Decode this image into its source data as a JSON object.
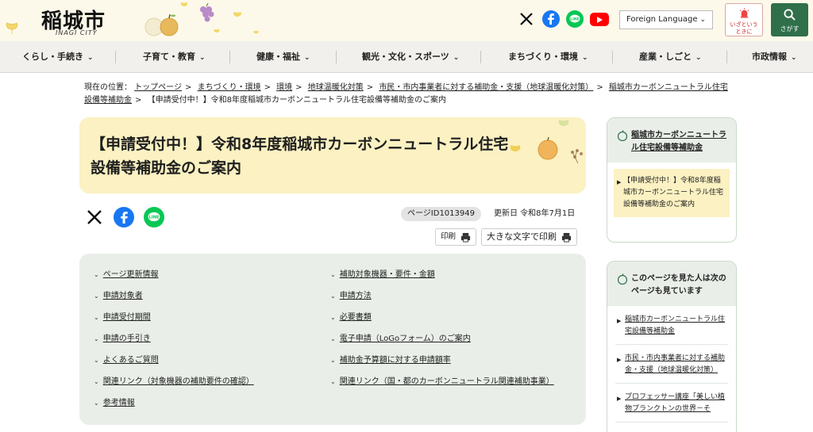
{
  "header": {
    "logo": "稲城市",
    "logo_sub": "INAGI CITY",
    "foreign_language": "Foreign Language",
    "emergency_label_1": "いざという",
    "emergency_label_2": "ときに",
    "search_label": "さがす"
  },
  "nav": {
    "items": [
      "くらし・手続き",
      "子育て・教育",
      "健康・福祉",
      "観光・文化・スポーツ",
      "まちづくり・環境",
      "産業・しごと",
      "市政情報"
    ]
  },
  "breadcrumb": {
    "prefix": "現在の位置：",
    "items": [
      "トップページ",
      "まちづくり・環境",
      "環境",
      "地球温暖化対策",
      "市民・市内事業者に対する補助金・支援（地球温暖化対策）",
      "稲城市カーボンニュートラル住宅設備等補助金"
    ],
    "current": "【申請受付中！】令和8年度稲城市カーボンニュートラル住宅設備等補助金のご案内"
  },
  "page": {
    "title": "【申請受付中！】令和8年度稲城市カーボンニュートラル住宅設備等補助金のご案内",
    "page_id": "ページID1013949",
    "updated": "更新日 令和8年7月1日",
    "print": "印刷",
    "print_large": "大きな文字で印刷"
  },
  "toc": {
    "left": [
      "ページ更新情報",
      "申請対象者",
      "申請受付期間",
      "申請の手引き",
      "よくあるご質問",
      "関連リンク（対象機器の補助要件の確認）",
      "参考情報"
    ],
    "right": [
      "補助対象機器・要件・金額",
      "申請方法",
      "必要書類",
      "電子申請（LoGoフォーム）のご案内",
      "補助金予算額に対する申請額率",
      "関連リンク（国・都のカーボンニュートラル関連補助事業）"
    ]
  },
  "side": {
    "category": "稲城市カーボンニュートラル住宅設備等補助金",
    "current": "【申請受付中！】令和8年度稲城市カーボンニュートラル住宅設備等補助金のご案内",
    "also_viewed": "このページを見た人は次のページも見ています",
    "links": [
      "稲城市カーボンニュートラル住宅設備等補助金",
      "市民・市内事業者に対する補助金・支援（地球温暖化対策）",
      "プロフェッサー講座「美しい植物プランクトンの世界－そ"
    ]
  },
  "colors": {
    "title_bg": "#fbf1c2",
    "toc_bg": "#e9efe8",
    "search_green": "#2f6f4a",
    "facebook": "#1877f2",
    "line": "#06c755",
    "youtube": "#ff0000"
  },
  "icons": [
    "x-icon",
    "facebook-icon",
    "line-icon",
    "youtube-icon",
    "alarm-icon",
    "search-icon",
    "printer-icon",
    "apple-icon"
  ]
}
